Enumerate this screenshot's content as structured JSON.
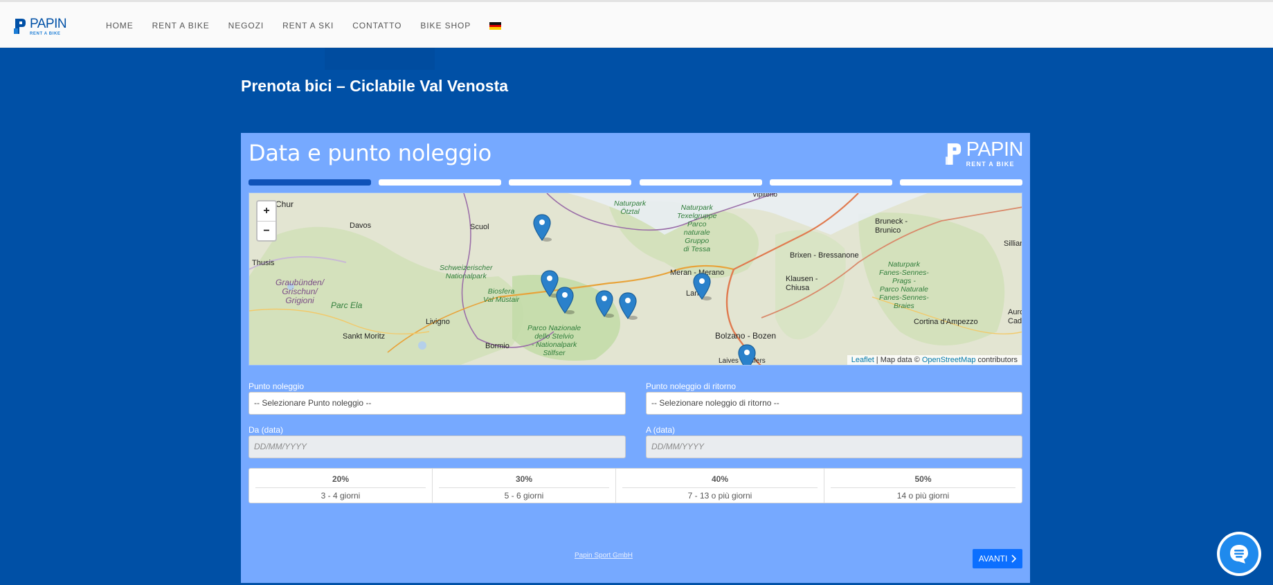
{
  "nav": {
    "logo_name": "PAPIN",
    "logo_sub": "RENT A BIKE",
    "items": [
      {
        "label": "HOME"
      },
      {
        "label": "RENT A BIKE"
      },
      {
        "label": "NEGOZI"
      },
      {
        "label": "RENT A SKI"
      },
      {
        "label": "CONTATTO"
      },
      {
        "label": "BIKE SHOP"
      }
    ],
    "language_flag": "german-flag-icon"
  },
  "page_title": "Prenota bici – Ciclabile Val Venosta",
  "panel": {
    "title": "Data e punto noleggio",
    "logo_name": "PAPIN",
    "logo_sub": "RENT A BIKE",
    "steps_total": 6,
    "active_step": 1
  },
  "map": {
    "zoom_in": "+",
    "zoom_out": "−",
    "labels": {
      "chur": "Chur",
      "davos": "Davos",
      "scuol": "Scuol",
      "thusis": "Thusis",
      "graubunden": "Graubünden/\nGrischun/\nGrigioni",
      "parc_ela": "Parc Ela",
      "sankt_moritz": "Sankt Moritz",
      "livigno": "Livigno",
      "bormio": "Bormio",
      "schweizerischer": "Schweizerischer\nNationalpark",
      "biosfera": "Biosfera\nVal Müstair",
      "stelvio": "Parco Nazionale\ndello Stelvio\n- Nationalpark\nStilfser",
      "naturpark_otztal": "Naturpark\nÖtztal",
      "texelgruppe": "Naturpark\nTexelgruppe\nParco\nnaturale\nGruppo\ndi Tessa",
      "vipiteno": "Vipiteno",
      "meran": "Meran - Merano",
      "lana": "Lana",
      "bolzano": "Bolzano - Bozen",
      "laives": "Laives - Leifers",
      "brixen": "Brixen - Bressanone",
      "klausen": "Klausen -\nChiusa",
      "bruneck": "Bruneck -\nBrunico",
      "fanes": "Naturpark\nFanes-Sennes-\nPrags -\nParco Naturale\nFanes-Sennes-\nBraies",
      "cortina": "Cortina d'Ampezzo",
      "sillian": "Sillian",
      "auronzo": "Auron\nCado"
    },
    "attribution": {
      "leaflet": "Leaflet",
      "mid": " | Map data © ",
      "osm": "OpenStreetMap",
      "tail": " contributors"
    }
  },
  "form": {
    "pickup_label": "Punto noleggio",
    "pickup_value": "-- Selezionare Punto noleggio --",
    "return_label": "Punto noleggio di ritorno",
    "return_value": "-- Selezionare noleggio di ritorno --",
    "from_label": "Da (data)",
    "from_placeholder": "DD/MM/YYYY",
    "to_label": "A (data)",
    "to_placeholder": "DD/MM/YYYY"
  },
  "discounts": [
    {
      "percent": "20%",
      "days": "3 - 4 giorni"
    },
    {
      "percent": "30%",
      "days": "5 - 6 giorni"
    },
    {
      "percent": "40%",
      "days": "7 - 13 o più giorni"
    },
    {
      "percent": "50%",
      "days": "14 o più giorni"
    }
  ],
  "footer": {
    "company_link": "Papin Sport GmbH",
    "next_button": "AVANTI"
  },
  "colors": {
    "background": "#0050a6",
    "panel": "#76a9ff",
    "active_step": "#0f52b8",
    "next_button": "#0c6fff",
    "chat_button": "#1f8aed"
  }
}
